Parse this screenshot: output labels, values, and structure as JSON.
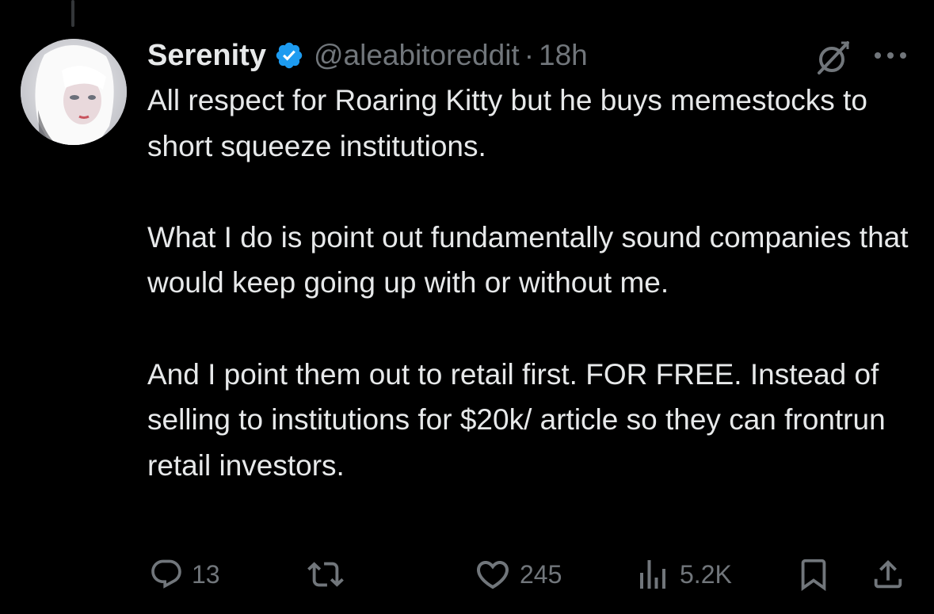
{
  "tweet": {
    "author": {
      "display_name": "Serenity",
      "handle": "@aleabitoreddit",
      "verified": true,
      "avatar": "avatar-white-hair-illustration"
    },
    "separator": "·",
    "time": "18h",
    "text": "All respect for Roaring Kitty but he buys memestocks to short squeeze institutions.\n\nWhat I do is point out fundamentally sound companies that would keep going up with or without me.\n\nAnd I point them out to retail first. FOR FREE. Instead of selling to institutions for $20k/ article so they can frontrun retail investors.",
    "header_icons": [
      "grok-icon",
      "more-icon"
    ],
    "actions": {
      "replies": "13",
      "reposts": "",
      "likes": "245",
      "views": "5.2K"
    },
    "action_icons": [
      "reply-icon",
      "repost-icon",
      "like-icon",
      "views-icon",
      "bookmark-icon",
      "share-icon"
    ]
  },
  "colors": {
    "background": "#000000",
    "text": "#e7e9ea",
    "muted": "#71767b",
    "verified_badge": "#1d9bf0",
    "thread_line": "#333639"
  }
}
